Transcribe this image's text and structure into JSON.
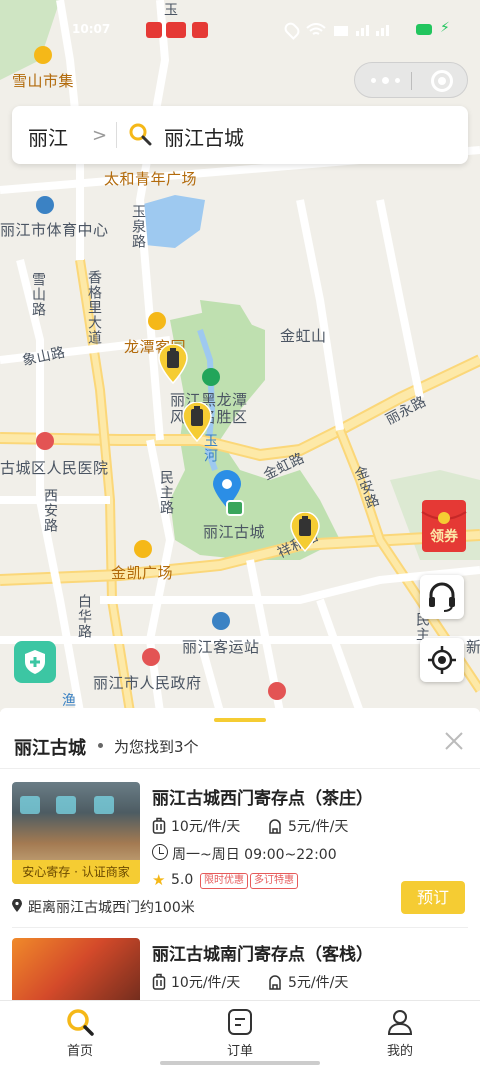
{
  "status_bar": {
    "time": "10:07",
    "battery_color": "#22c55e"
  },
  "search": {
    "city": "丽江",
    "query": "丽江古城"
  },
  "map": {
    "labels": {
      "xueshan_market": "雪山市集",
      "taihe_square": "太和青年广场",
      "sports_center": "丽江市体育中心",
      "yuquan_road": "玉泉路",
      "xueshan_road": "雪山路",
      "xianggelila_road": "香格里大道",
      "xiangshan_road": "象山路",
      "longtan_hotel": "龙潭客园",
      "jinhong_mountain": "金虹山",
      "heilongtan": "丽江黑龙潭风景名胜区",
      "yuhe": "玉河",
      "yuquan_top": "玉",
      "fuyong_road": "丽永路",
      "jinhong_road": "金虹路",
      "jinan_road": "金安路",
      "people_hospital": "古城区人民医院",
      "xian_road": "西安路",
      "minzhu_road": "民主路",
      "lijiang_old_town": "丽江古城",
      "xiangtai_road": "祥和路",
      "jinkai_square": "金凯广场",
      "baihua_road": "白华路",
      "bus_station": "丽江客运站",
      "city_hall": "丽江市人民政府",
      "yu_road": "渔",
      "xin": "新",
      "minzhu_east": "民主"
    },
    "coupon_label": "领券",
    "accent_color": "#f5cc33",
    "pin_color": "#2b8ee6"
  },
  "sheet": {
    "title": "丽江古城",
    "result_count": "为您找到3个",
    "items": [
      {
        "name": "丽江古城西门寄存点（茶庄）",
        "big_price": "10元/件/天",
        "small_price": "5元/件/天",
        "hours": "周一~周日 09:00~22:00",
        "rating": "5.0",
        "badge1": "限时优惠",
        "badge2": "多订特惠",
        "image_tag": "安心寄存 · 认证商家",
        "distance": "距离丽江古城西门约100米",
        "book_label": "预订"
      },
      {
        "name": "丽江古城南门寄存点（客栈）",
        "big_price": "10元/件/天",
        "small_price": "5元/件/天"
      }
    ]
  },
  "tabs": [
    {
      "label": "首页",
      "icon": "search-icon"
    },
    {
      "label": "订单",
      "icon": "order-icon"
    },
    {
      "label": "我的",
      "icon": "profile-icon"
    }
  ]
}
